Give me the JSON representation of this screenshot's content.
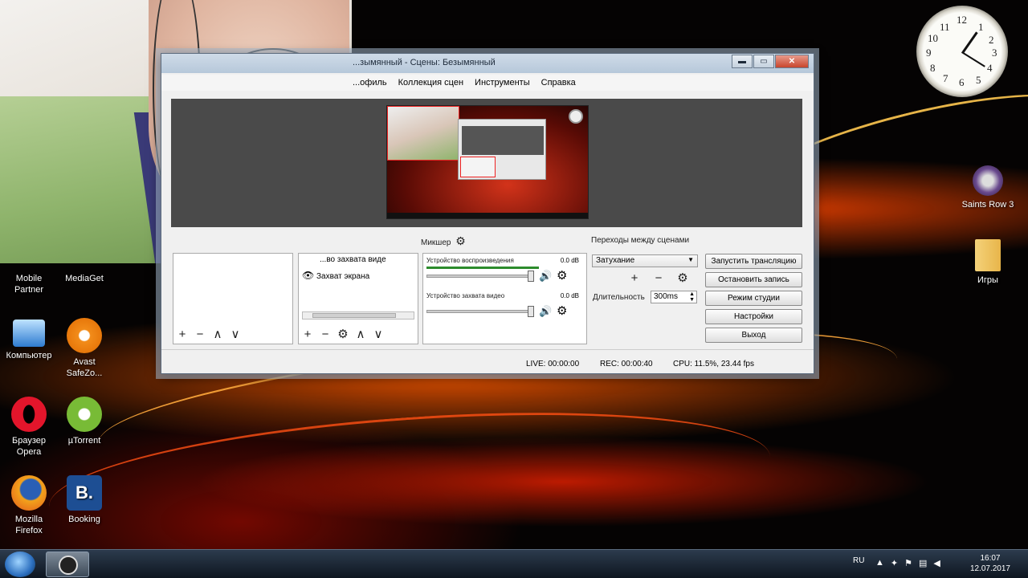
{
  "desktop": {
    "icons_left": [
      {
        "label": "Mobile\nPartner",
        "icon": "mobile-partner-icon"
      },
      {
        "label": "MediaGet",
        "icon": "mediaget-icon"
      },
      {
        "label": "Компьютер",
        "icon": "computer-icon"
      },
      {
        "label": "Avast\nSafeZo...",
        "icon": "avast-icon"
      },
      {
        "label": "Браузер\nOpera",
        "icon": "opera-icon"
      },
      {
        "label": "µTorrent",
        "icon": "utorrent-icon"
      },
      {
        "label": "Mozilla\nFirefox",
        "icon": "firefox-icon"
      },
      {
        "label": "Booking",
        "icon": "booking-icon"
      }
    ],
    "icons_right": [
      {
        "label": "Saints Row 3",
        "icon": "saints-row-icon"
      },
      {
        "label": "Игры",
        "icon": "games-folder-icon"
      }
    ],
    "clock_numbers": [
      "12",
      "1",
      "2",
      "3",
      "4",
      "5",
      "6",
      "7",
      "8",
      "9",
      "10",
      "11"
    ]
  },
  "obs": {
    "title": "...зымянный - Сцены: Безымянный",
    "window_buttons": {
      "minimize": "▬",
      "maximize": "▭",
      "close": "✕"
    },
    "menu": [
      "...офиль",
      "Коллекция сцен",
      "Инструменты",
      "Справка"
    ],
    "sources": {
      "items": [
        "...во захвата виде",
        "Захват экрана"
      ]
    },
    "mixer": {
      "label": "Микшер",
      "tracks": [
        {
          "name": "Устройство воспроизведения",
          "db": "0.0 dB"
        },
        {
          "name": "Устройство захвата видео",
          "db": "0.0 dB"
        }
      ]
    },
    "transitions": {
      "label": "Переходы между сценами",
      "selected": "Затухание",
      "duration_label": "Длительность",
      "duration_value": "300ms"
    },
    "buttons": [
      "Запустить трансляцию",
      "Остановить запись",
      "Режим студии",
      "Настройки",
      "Выход"
    ],
    "status": {
      "live": "LIVE: 00:00:00",
      "rec": "REC: 00:00:40",
      "cpu": "CPU: 11.5%, 23.44 fps"
    },
    "toolbar_glyphs": {
      "add": "+",
      "remove": "−",
      "up": "∧",
      "down": "∨",
      "settings": "⚙"
    }
  },
  "taskbar": {
    "lang": "RU",
    "time": "16:07",
    "date": "12.07.2017"
  }
}
